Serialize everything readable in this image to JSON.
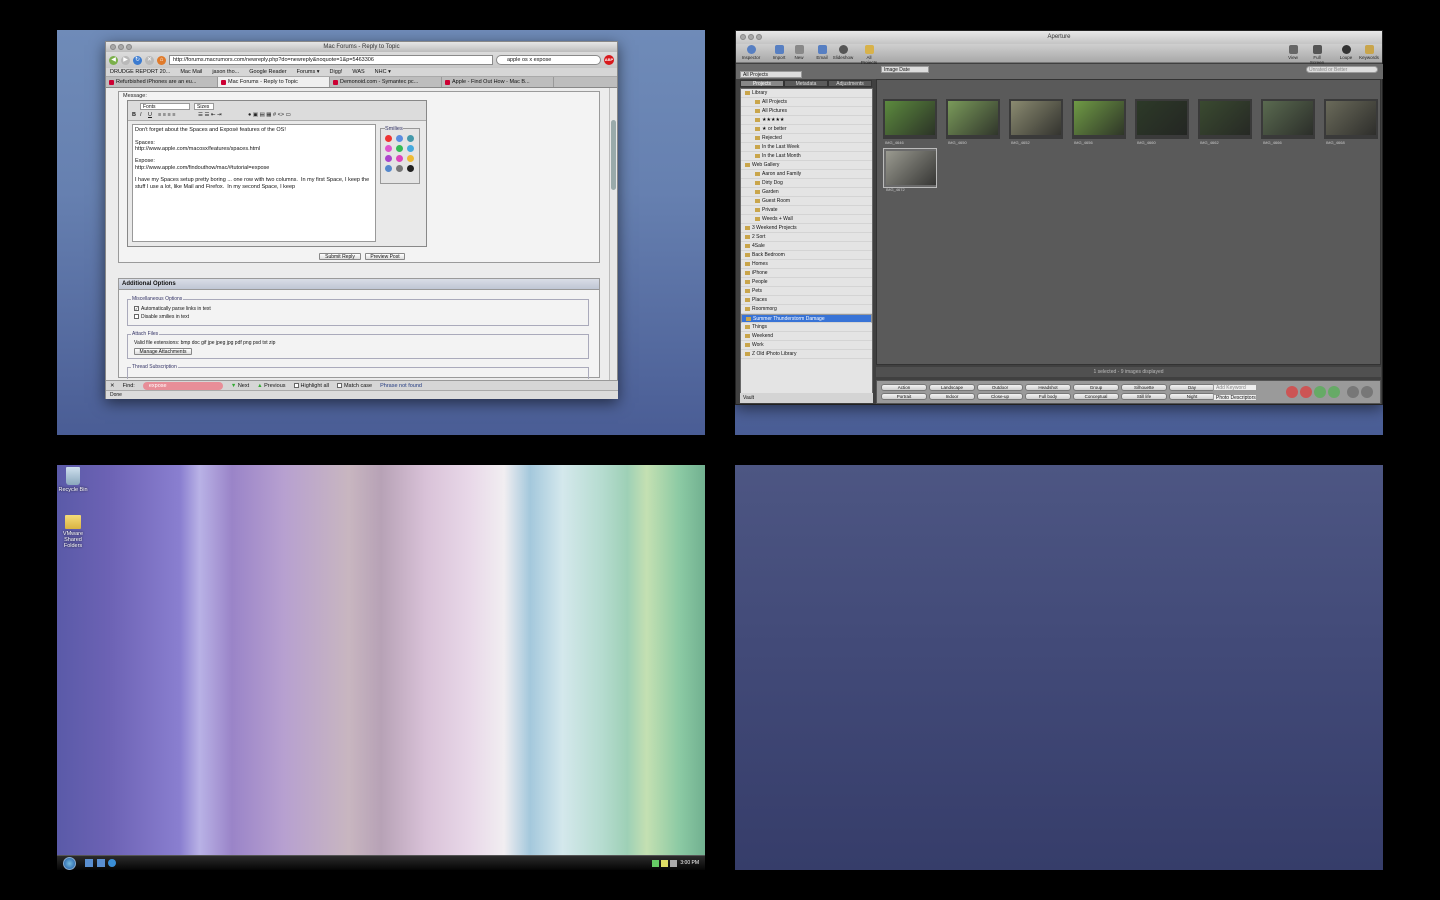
{
  "firefox": {
    "title": "Mac Forums - Reply to Topic",
    "url": "http://forums.macrumors.com/newreply.php?do=newreply&noquote=1&p=5463306",
    "search": "apple os x expose",
    "abp": "ABP",
    "bookmarks": [
      "DRUDGE REPORT 20...",
      "Mac Mail",
      "jason tho...",
      "Google Reader",
      "Forums ▾",
      "Digg!",
      "WAS",
      "NHC ▾"
    ],
    "tabs": [
      "Refurbished iPhones are an eu...",
      "Mac Forums - Reply to Topic",
      "Demonoid.com - Symantec pc...",
      "Apple - Find Out How - Mac B..."
    ],
    "message_label": "Message:",
    "fonts_select": "Fonts",
    "sizes_select": "Sizes",
    "editor_text": "Don't forget about the Spaces and Exposé features of the OS!\n\nSpaces:\nhttp://www.apple.com/macosx/features/spaces.html\n\nExpose:\nhttp://www.apple.com/findouthow/mac/#tutorial=expose\n\nI have my Spaces setup pretty boring ... one row with two columns.  In my first Space, I keep the stuff I use a lot, like Mail and Firefox.  In my second Space, I keep",
    "smilies_label": "Smilies",
    "submit": "Submit Reply",
    "preview": "Preview Post",
    "additional": "Additional Options",
    "misc_legend": "Miscellaneous Options",
    "auto_parse": "Automatically parse links in text",
    "disable_smilies": "Disable smilies in text",
    "attach_legend": "Attach Files",
    "valid_ext": "Valid file extensions: bmp doc gif jpe jpeg jpg pdf png psd txt zip",
    "manage": "Manage Attachments",
    "thread_legend": "Thread Subscription",
    "find_label": "Find:",
    "find_value": "expose",
    "next": "Next",
    "previous": "Previous",
    "highlight": "Highlight all",
    "matchcase": "Match case",
    "notfound": "Phrase not found",
    "status": "Done"
  },
  "aperture": {
    "title": "Aperture",
    "toolbar_left": [
      "Inspector",
      "Import",
      "New",
      "Email",
      "Slideshow",
      "All Projects"
    ],
    "toolbar_right": [
      "View",
      "Full Screen",
      "Loupe",
      "Keywords"
    ],
    "tabs": [
      "Projects",
      "Metadata",
      "Adjustments"
    ],
    "all_projects": "All Projects",
    "sort": "Image Date",
    "search_placeholder": "Unrated or Better",
    "library": [
      {
        "label": "Library",
        "indent": 0,
        "sel": false
      },
      {
        "label": "All Projects",
        "indent": 1,
        "sel": false
      },
      {
        "label": "All Pictures",
        "indent": 1,
        "sel": false
      },
      {
        "label": "★★★★★",
        "indent": 1,
        "sel": false
      },
      {
        "label": "★ or better",
        "indent": 1,
        "sel": false
      },
      {
        "label": "Rejected",
        "indent": 1,
        "sel": false
      },
      {
        "label": "In the Last Week",
        "indent": 1,
        "sel": false
      },
      {
        "label": "In the Last Month",
        "indent": 1,
        "sel": false
      },
      {
        "label": "Web Gallery",
        "indent": 0,
        "sel": false
      },
      {
        "label": "Aaron and Family",
        "indent": 1,
        "sel": false
      },
      {
        "label": "Dirty Dog",
        "indent": 1,
        "sel": false
      },
      {
        "label": "Garden",
        "indent": 1,
        "sel": false
      },
      {
        "label": "Guest Room",
        "indent": 1,
        "sel": false
      },
      {
        "label": "Private",
        "indent": 1,
        "sel": false
      },
      {
        "label": "Weeds + Wall",
        "indent": 1,
        "sel": false
      },
      {
        "label": "3 Weekend Projects",
        "indent": 0,
        "sel": false
      },
      {
        "label": "2 Sort",
        "indent": 0,
        "sel": false
      },
      {
        "label": "4Sale",
        "indent": 0,
        "sel": false
      },
      {
        "label": "Back Bedroom",
        "indent": 0,
        "sel": false
      },
      {
        "label": "Homes",
        "indent": 0,
        "sel": false
      },
      {
        "label": "iPhone",
        "indent": 0,
        "sel": false
      },
      {
        "label": "People",
        "indent": 0,
        "sel": false
      },
      {
        "label": "Pets",
        "indent": 0,
        "sel": false
      },
      {
        "label": "Places",
        "indent": 0,
        "sel": false
      },
      {
        "label": "Roommorg",
        "indent": 0,
        "sel": false
      },
      {
        "label": "Summer Thunderstorm Damage",
        "indent": 0,
        "sel": true
      },
      {
        "label": "Things",
        "indent": 0,
        "sel": false
      },
      {
        "label": "Weekend",
        "indent": 0,
        "sel": false
      },
      {
        "label": "Work",
        "indent": 0,
        "sel": false
      },
      {
        "label": "Z Old iPhoto Library",
        "indent": 0,
        "sel": false
      }
    ],
    "vault": "Vault",
    "thumbs": [
      {
        "cap": "IMG_4646",
        "c": "#5c8a3e"
      },
      {
        "cap": "IMG_4650",
        "c": "#7a9a5a"
      },
      {
        "cap": "IMG_4652",
        "c": "#8a8a70"
      },
      {
        "cap": "IMG_4656",
        "c": "#6f9a45"
      },
      {
        "cap": "IMG_4660",
        "c": "#2d3a28"
      },
      {
        "cap": "IMG_4662",
        "c": "#3a4a30"
      },
      {
        "cap": "IMG_4666",
        "c": "#5a6a50"
      },
      {
        "cap": "IMG_4668",
        "c": "#6a6a5a"
      },
      {
        "cap": "IMG_4672",
        "c": "#9a9a90"
      }
    ],
    "status": "1 selected - 9 images displayed",
    "keywords": [
      "Action",
      "Landscape",
      "Outdoor",
      "Headshot",
      "Group",
      "Silhouette",
      "Day",
      "Portrait",
      "Indoor",
      "Close-up",
      "Full body",
      "Conceptual",
      "Still life",
      "Night"
    ],
    "add_keyword": "Add Keyword",
    "preset": "Photo Descriptors"
  },
  "windows": {
    "recycle": "Recycle Bin",
    "folder": "VMware Shared Folders",
    "clock": "3:00 PM"
  }
}
